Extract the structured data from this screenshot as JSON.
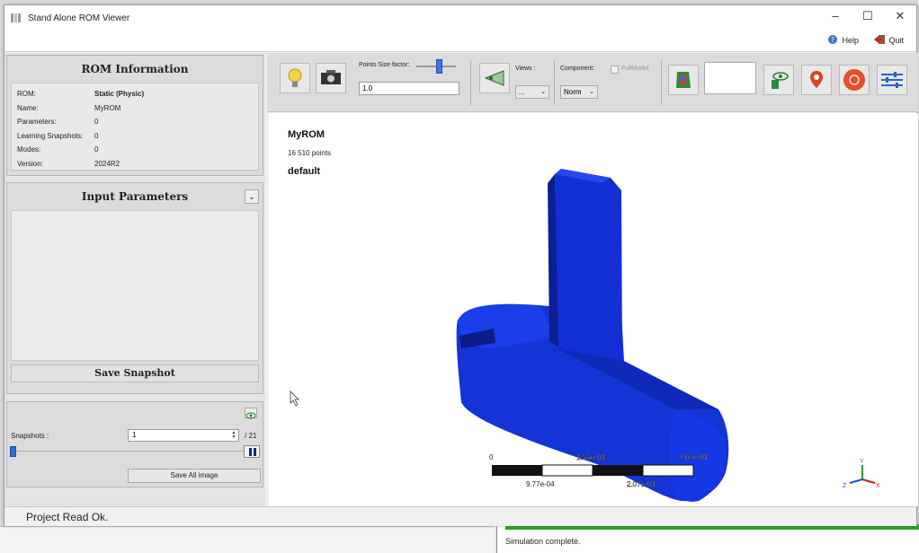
{
  "window": {
    "title": "Stand Alone ROM Viewer"
  },
  "menu": {
    "help": "Help",
    "quit": "Quit"
  },
  "rom_info": {
    "header": "ROM Information",
    "rows": [
      {
        "key": "ROM:",
        "value": "Static (Physic)"
      },
      {
        "key": "Name:",
        "value": "MyROM"
      },
      {
        "key": "Parameters:",
        "value": "0"
      },
      {
        "key": "Learning Snapshots:",
        "value": "0"
      },
      {
        "key": "Modes:",
        "value": "0"
      },
      {
        "key": "Version:",
        "value": "2024R2"
      }
    ]
  },
  "input_params": {
    "header": "Input Parameters",
    "save_snapshot": "Save Snapshot"
  },
  "snapshots": {
    "label": "Snapshots :",
    "value": "1",
    "total": "/ 21",
    "save_all": "Save All image"
  },
  "toolbar": {
    "points_size_label": "Points Size factor:",
    "points_size_value": "1.0",
    "views_label": "Views :",
    "views_value": "...",
    "component_label": "Component:",
    "component_value": "Norm",
    "fullmodel_label": "FullModel"
  },
  "viewport": {
    "title": "MyROM",
    "points": "16 510 points",
    "default": "default",
    "scale": {
      "min": "0",
      "mid1": "1.55e-03",
      "max": "2.07e-03",
      "lower1": "9.77e-04",
      "lower2": "2.07e-03"
    }
  },
  "status": "Project Read Ok.",
  "background_window": {
    "status": "Simulation complete."
  }
}
